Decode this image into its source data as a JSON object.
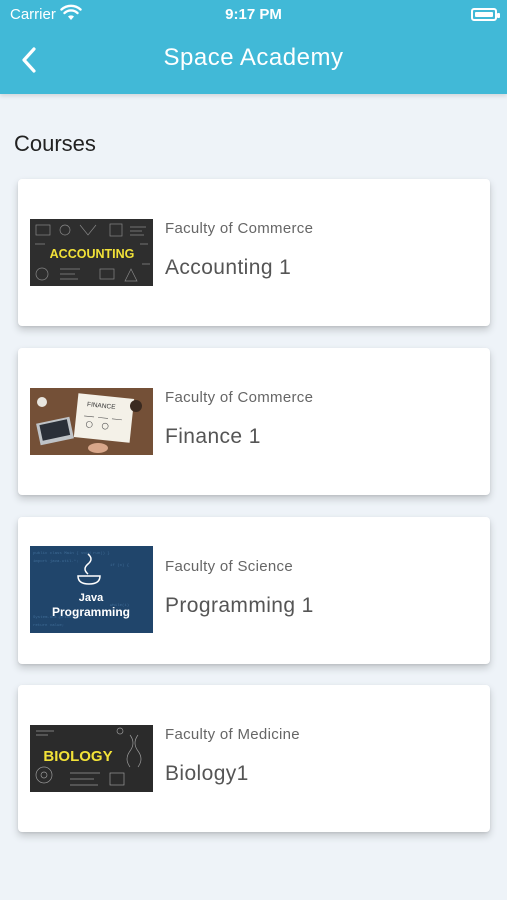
{
  "status_bar": {
    "carrier": "Carrier",
    "time": "9:17 PM"
  },
  "header": {
    "title": "Space Academy",
    "back_icon": "chevron-left-icon"
  },
  "section": {
    "title": "Courses"
  },
  "courses": [
    {
      "faculty": "Faculty of Commerce",
      "name": "Accounting 1",
      "image_text": "ACCOUNTING"
    },
    {
      "faculty": "Faculty of Commerce",
      "name": "Finance 1",
      "image_text": "FINANCE"
    },
    {
      "faculty": "Faculty of Science",
      "name": "Programming 1",
      "image_text_1": "Java",
      "image_text_2": "Programming"
    },
    {
      "faculty": "Faculty of Medicine",
      "name": "Biology1",
      "image_text": "BIOLOGY"
    }
  ],
  "colors": {
    "header": "#41b9d7",
    "background": "#eef3f8",
    "card": "#ffffff"
  }
}
